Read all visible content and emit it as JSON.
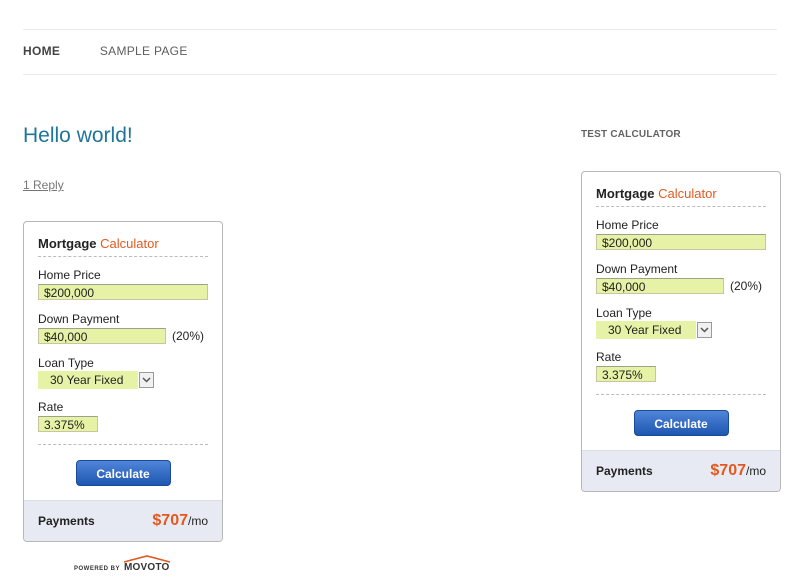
{
  "nav": {
    "items": [
      {
        "label": "HOME"
      },
      {
        "label": "SAMPLE PAGE"
      }
    ]
  },
  "post": {
    "title": "Hello world!",
    "reply_link": "1 Reply"
  },
  "widget": {
    "title": "TEST CALCULATOR"
  },
  "calculator": {
    "title_main": "Mortgage",
    "title_accent": "Calculator",
    "home_price_label": "Home Price",
    "home_price_value": "$200,000",
    "down_payment_label": "Down Payment",
    "down_payment_value": "$40,000",
    "down_payment_pct": "(20%)",
    "loan_type_label": "Loan Type",
    "loan_type_value": "30 Year Fixed",
    "rate_label": "Rate",
    "rate_value": "3.375%",
    "button_label": "Calculate",
    "payments_label": "Payments",
    "payments_amount": "$707",
    "payments_unit": "/mo"
  },
  "powered": {
    "prefix": "POWERED BY",
    "brand": "MOVOTO"
  },
  "colors": {
    "accent": "#e2591f",
    "link_blue": "#21759b",
    "input_bg": "#e6f2a6",
    "button_blue": "#2a62bf"
  },
  "icons": {
    "select_arrow": "chevron-down-icon",
    "logo_roof": "house-roof-icon"
  }
}
